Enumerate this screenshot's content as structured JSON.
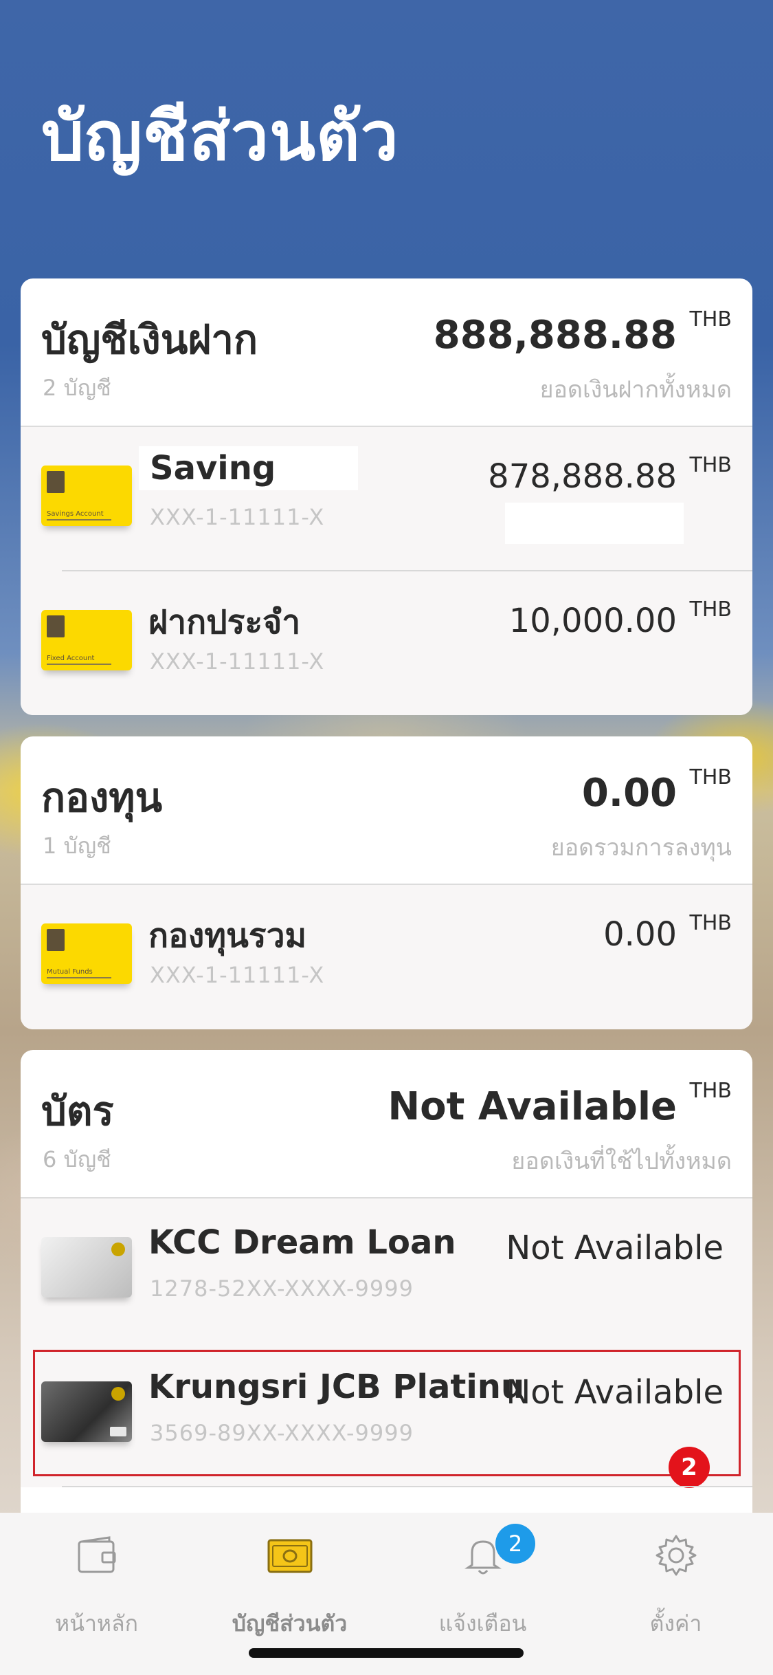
{
  "page_title": "บัญชีส่วนตัว",
  "deposit": {
    "title": "บัญชีเงินฝาก",
    "count": "2 บัญชี",
    "total": "888,888.88",
    "currency": "THB",
    "total_label": "ยอดเงินฝากทั้งหมด",
    "accounts": [
      {
        "name": "Saving",
        "number": "XXX-1-11111-X",
        "amount": "878,888.88",
        "currency": "THB",
        "card_label": "Savings Account"
      },
      {
        "name": "ฝากประจำ",
        "number": "XXX-1-11111-X",
        "amount": "10,000.00",
        "currency": "THB",
        "card_label": "Fixed Account"
      }
    ]
  },
  "funds": {
    "title": "กองทุน",
    "count": "1 บัญชี",
    "total": "0.00",
    "currency": "THB",
    "total_label": "ยอดรวมการลงทุน",
    "accounts": [
      {
        "name": "กองทุนรวม",
        "number": "XXX-1-11111-X",
        "amount": "0.00",
        "currency": "THB",
        "card_label": "Mutual Funds"
      }
    ]
  },
  "cards": {
    "title": "บัตร",
    "count": "6 บัญชี",
    "total": "Not Available",
    "currency": "THB",
    "total_label": "ยอดเงินที่ใช้ไปทั้งหมด",
    "accounts": [
      {
        "name": "KCC Dream Loan",
        "number": "1278-52XX-XXXX-9999",
        "amount": "Not Available"
      },
      {
        "name": "Krungsri JCB Platinu",
        "number": "3569-89XX-XXXX-9999",
        "amount": "Not Available"
      }
    ],
    "annotation_badge": "2"
  },
  "tabbar": {
    "items": [
      {
        "label": "หน้าหลัก",
        "icon": "wallet-icon"
      },
      {
        "label": "บัญชีส่วนตัว",
        "icon": "banknote-icon",
        "active": true
      },
      {
        "label": "แจ้งเตือน",
        "icon": "bell-icon",
        "badge": "2"
      },
      {
        "label": "ตั้งค่า",
        "icon": "gear-icon"
      }
    ]
  },
  "colors": {
    "accent_yellow": "#fcd900",
    "header_blue": "#3f66a8",
    "badge_blue": "#1e9be9",
    "highlight_red": "#d0242b"
  }
}
